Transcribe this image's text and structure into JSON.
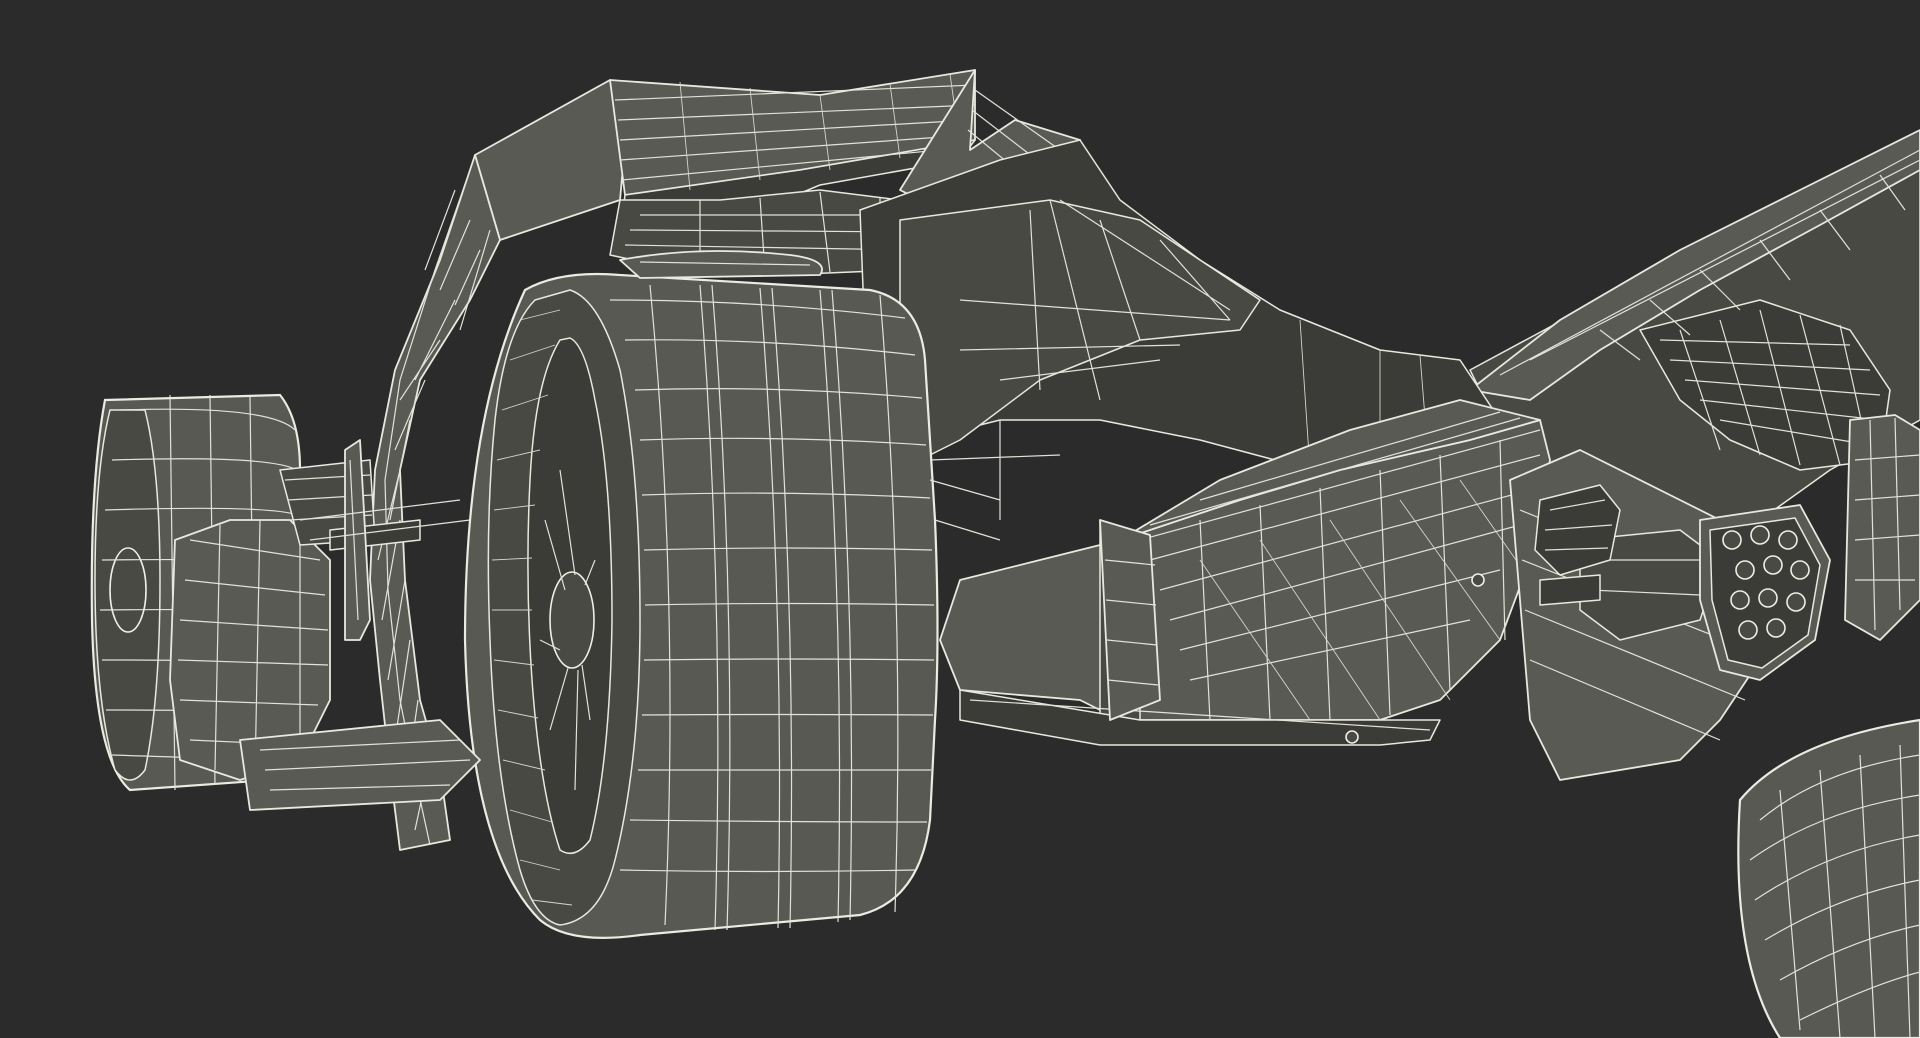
{
  "scene": {
    "background_color": "#2b2b2b",
    "wire_color": "#e9e8df",
    "surface_color": "#5a5a55"
  }
}
